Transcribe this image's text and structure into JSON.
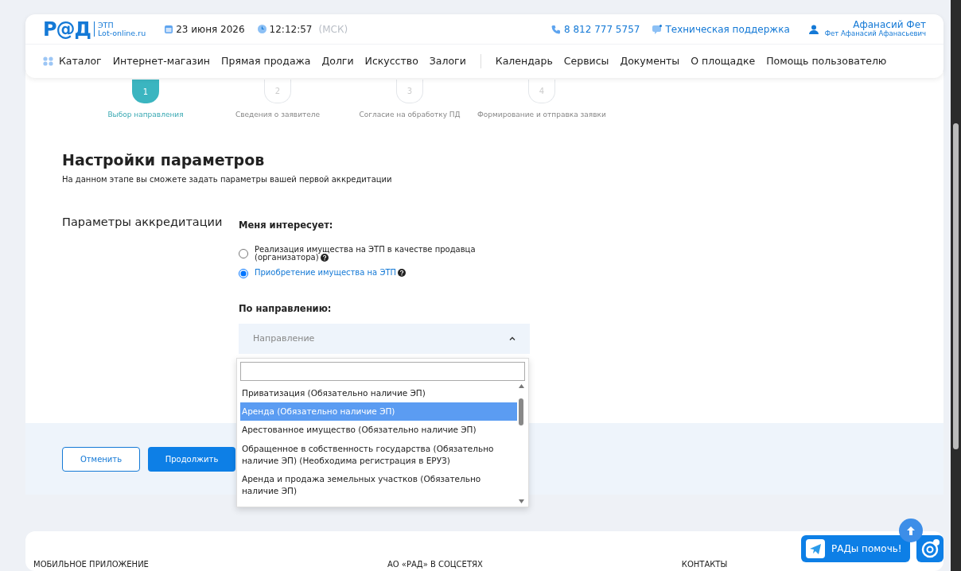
{
  "header": {
    "logo": {
      "mark": "Р@Д",
      "etp": "ЭТП",
      "site": "Lot-online.ru"
    },
    "date": "23 июня 2026",
    "time": "12:12:57",
    "timezone": "(МСК)",
    "phone": "8 812 777 5757",
    "support": "Техническая поддержка",
    "user": {
      "name": "Афанасий Фет",
      "full_name": "Фет Афанасий Афанасьевич"
    }
  },
  "nav": {
    "items": [
      "Каталог",
      "Интернет-магазин",
      "Прямая продажа",
      "Долги",
      "Искусство",
      "Залоги",
      "Календарь",
      "Сервисы",
      "Документы",
      "О площадке",
      "Помощь пользователю"
    ]
  },
  "stepper": [
    {
      "number": "1",
      "label": "Выбор направления",
      "selected": true
    },
    {
      "number": "2",
      "label": "Сведения о заявителе",
      "selected": false
    },
    {
      "number": "3",
      "label": "Согласие на обработку ПД",
      "selected": false
    },
    {
      "number": "4",
      "label": "Формирование и отправка заявки",
      "selected": false
    }
  ],
  "title": "Настройки параметров",
  "subtitle": "На данном этапе вы сможете задать параметры вашей первой аккредитации",
  "section_label": "Параметры аккредитации",
  "interest": {
    "label": "Меня интересует:",
    "options": [
      {
        "label": "Реализация имущества на ЭТП в качестве продавца (организатора)",
        "selected": false
      },
      {
        "label": "Приобретение имущества на ЭТП",
        "selected": true
      }
    ]
  },
  "direction": {
    "label": "По направлению:",
    "placeholder": "Направление",
    "expanded": true,
    "options": [
      {
        "label": "Приватизация (Обязательно наличие ЭП)",
        "selected": false
      },
      {
        "label": "Аренда (Обязательно наличие ЭП)",
        "selected": true
      },
      {
        "label": "Арестованное имущество (Обязательно наличие ЭП)",
        "selected": false
      },
      {
        "label": "Обращенное в собственность государства (Обязательно наличие ЭП) (Необходима регистрация в ЕРУЗ)",
        "selected": false
      },
      {
        "label": "Аренда и продажа земельных участков (Обязательно наличие ЭП)",
        "selected": false
      }
    ]
  },
  "buttons": {
    "cancel": "Отменить",
    "continue": "Продолжить"
  },
  "footer": {
    "columns": [
      "МОБИЛЬНОЕ ПРИЛОЖЕНИЕ",
      "АО «РАД» В СОЦСЕТЯХ",
      "КОНТАКТЫ"
    ]
  },
  "chat_button": "РАДы помочь!"
}
